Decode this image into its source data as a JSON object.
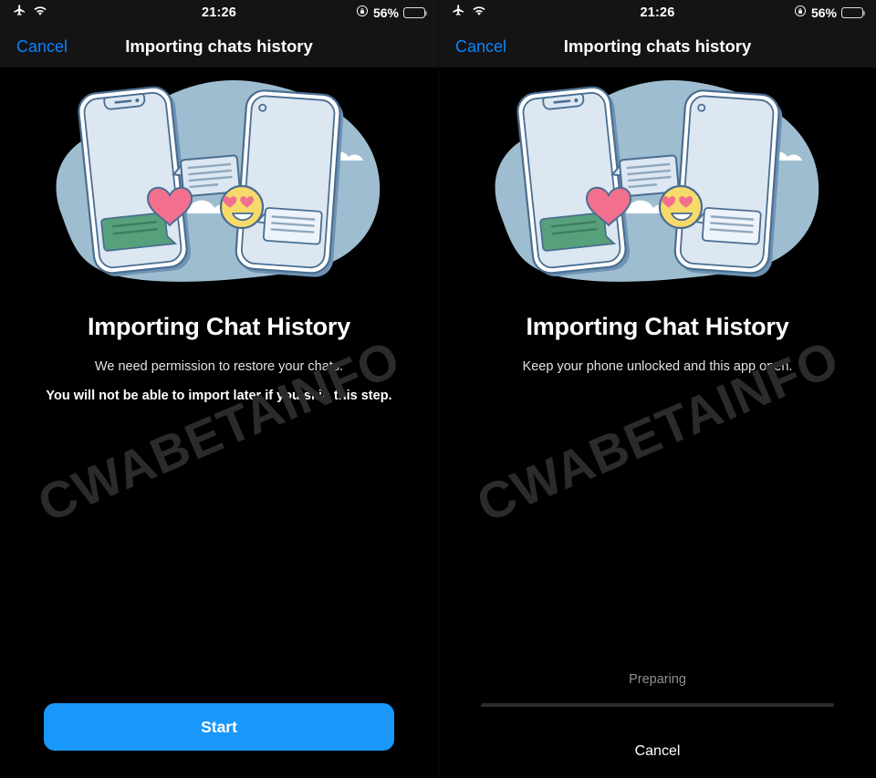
{
  "statusbar": {
    "airplane_icon": "airplane-mode-icon",
    "wifi_icon": "wifi-icon",
    "time": "21:26",
    "rotation_lock_icon": "rotation-lock-icon",
    "battery_percent": "56%",
    "battery_level": 56,
    "battery_color": "#FCCC0A"
  },
  "navbar": {
    "cancel_label": "Cancel",
    "title": "Importing chats history",
    "cancel_color": "#0A84FF"
  },
  "watermark": {
    "text": "CWABETAINFO"
  },
  "illustration": {
    "name": "two-phones-chat-transfer-illustration",
    "blob_color": "#9FBDD0",
    "phone_body_color": "#DCE7F2",
    "phone_outline_color": "#4A6E91",
    "phone_shadow_color": "#6E93B4",
    "heart_color": "#F2708E",
    "emoji_color": "#F7DB6A",
    "green_bubble_color": "#56A17B",
    "cloud_color": "#FFFFFF"
  },
  "left_screen": {
    "heading": "Importing Chat History",
    "subtitle": "We need permission to restore your chats.",
    "warning": "You will not be able to import later if you skip this step.",
    "start_label": "Start",
    "start_color": "#1A97FB"
  },
  "right_screen": {
    "heading": "Importing Chat History",
    "subtitle": "Keep your phone unlocked and this app open.",
    "progress_label": "Preparing",
    "progress_percent": 0,
    "cancel_label": "Cancel",
    "track_color": "#2C2C2E"
  }
}
